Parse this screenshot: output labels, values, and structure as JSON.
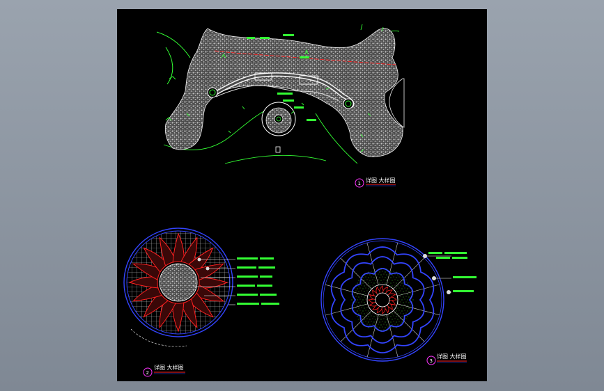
{
  "sheet": {
    "background": "#000000",
    "titles": [
      {
        "number": "1",
        "label": "详图 大样图"
      },
      {
        "number": "2",
        "label": "详图 大样图"
      },
      {
        "number": "3",
        "label": "详图 大样图"
      }
    ],
    "colors": {
      "paving": "#bdbdbd",
      "green_lines": "#33ff33",
      "red_axis": "#ff2020",
      "blue_lines": "#3344ff",
      "magenta_bubble": "#ff33ff",
      "white": "#ffffff"
    }
  }
}
